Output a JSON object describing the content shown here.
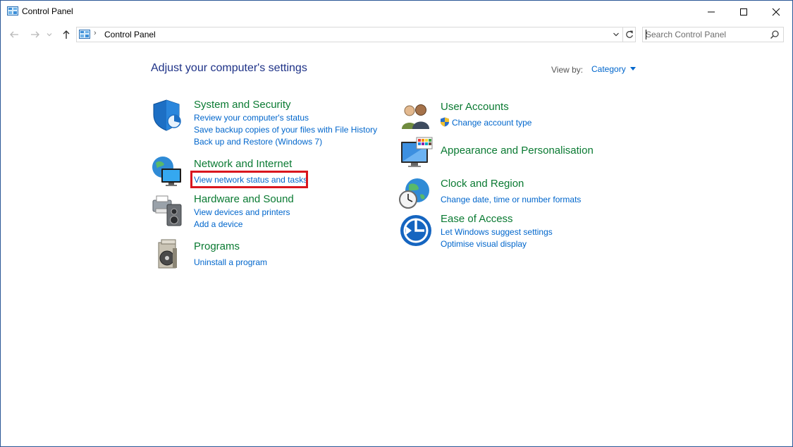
{
  "window": {
    "title": "Control Panel",
    "controls": {
      "minimize": "minimize-icon",
      "maximize": "maximize-icon",
      "close": "close-icon"
    }
  },
  "navigation": {
    "back_icon": "back-arrow-icon",
    "forward_icon": "forward-arrow-icon",
    "recent_icon": "chevron-down-icon",
    "up_icon": "up-arrow-icon",
    "address": {
      "separator": "›",
      "path": "Control Panel"
    },
    "search": {
      "placeholder": "Search Control Panel",
      "value": ""
    }
  },
  "content": {
    "heading": "Adjust your computer's settings",
    "view_by": {
      "label": "View by:",
      "value": "Category"
    },
    "categories_left": [
      {
        "title": "System and Security",
        "icon": "shield-icon",
        "links": [
          "Review your computer's status",
          "Save backup copies of your files with File History",
          "Back up and Restore (Windows 7)"
        ]
      },
      {
        "title": "Network and Internet",
        "icon": "network-globe-icon",
        "links": [
          "View network status and tasks"
        ]
      },
      {
        "title": "Hardware and Sound",
        "icon": "printer-speaker-icon",
        "links": [
          "View devices and printers",
          "Add a device"
        ]
      },
      {
        "title": "Programs",
        "icon": "programs-disc-icon",
        "links": [
          "Uninstall a program"
        ]
      }
    ],
    "categories_right": [
      {
        "title": "User Accounts",
        "icon": "users-icon",
        "links": [
          "Change account type"
        ],
        "link_icon": "uac-shield-icon"
      },
      {
        "title": "Appearance and Personalisation",
        "icon": "monitor-palette-icon",
        "links": []
      },
      {
        "title": "Clock and Region",
        "icon": "clock-globe-icon",
        "links": [
          "Change date, time or number formats"
        ]
      },
      {
        "title": "Ease of Access",
        "icon": "ease-of-access-icon",
        "links": [
          "Let Windows suggest settings",
          "Optimise visual display"
        ]
      }
    ]
  },
  "colors": {
    "heading": "#1e3287",
    "category_title": "#0a7a32",
    "link": "#0066cc",
    "highlight_box": "#d9161e",
    "window_border": "#2b5797"
  }
}
